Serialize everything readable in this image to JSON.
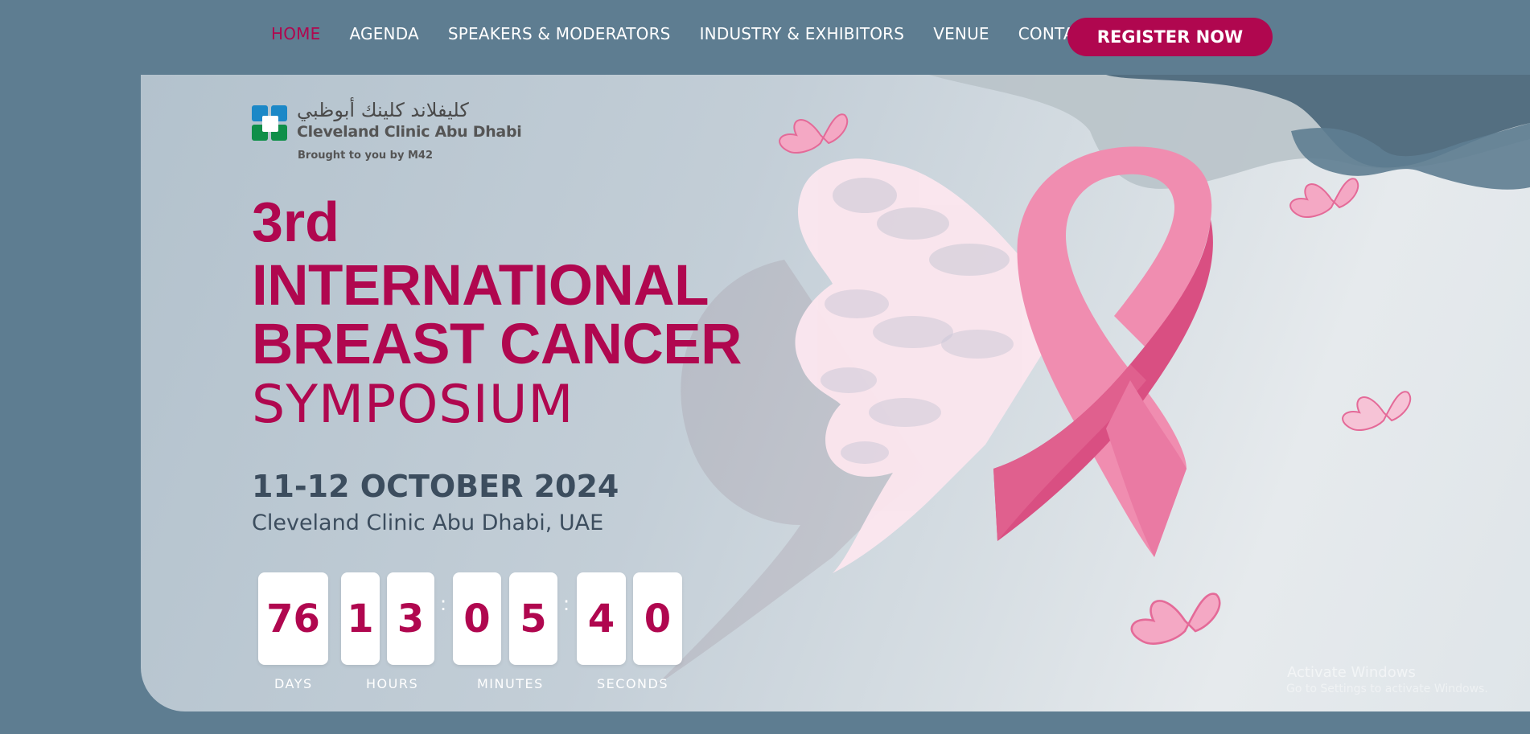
{
  "nav": {
    "items": [
      {
        "label": "HOME",
        "active": true
      },
      {
        "label": "AGENDA",
        "active": false
      },
      {
        "label": "SPEAKERS & MODERATORS",
        "active": false
      },
      {
        "label": "INDUSTRY & EXHIBITORS",
        "active": false
      },
      {
        "label": "VENUE",
        "active": false
      },
      {
        "label": "CONTACT",
        "active": false
      }
    ],
    "register_label": "REGISTER NOW"
  },
  "logo": {
    "arabic": "كليفلاند كلينك أبوظبي",
    "english": "Cleveland Clinic Abu Dhabi",
    "tagline": "Brought to you by M42"
  },
  "hero": {
    "edition": "3rd",
    "line1": "INTERNATIONAL",
    "line2": "BREAST CANCER",
    "line3": "SYMPOSIUM",
    "dates": "11-12 OCTOBER 2024",
    "location": "Cleveland Clinic Abu Dhabi, UAE"
  },
  "countdown": {
    "days": "76",
    "hours": [
      "1",
      "3"
    ],
    "minutes": [
      "0",
      "5"
    ],
    "seconds": [
      "4",
      "0"
    ],
    "separator": ":",
    "labels": {
      "days": "DAYS",
      "hours": "HOURS",
      "minutes": "MINUTES",
      "seconds": "SECONDS"
    }
  },
  "watermark": {
    "line1": "Activate Windows",
    "line2": "Go to Settings to activate Windows."
  },
  "colors": {
    "accent": "#b0074f",
    "nav_bg": "#5e7d91",
    "heading_dark": "#3c4d5e",
    "ribbon_pink": "#e0608e"
  }
}
